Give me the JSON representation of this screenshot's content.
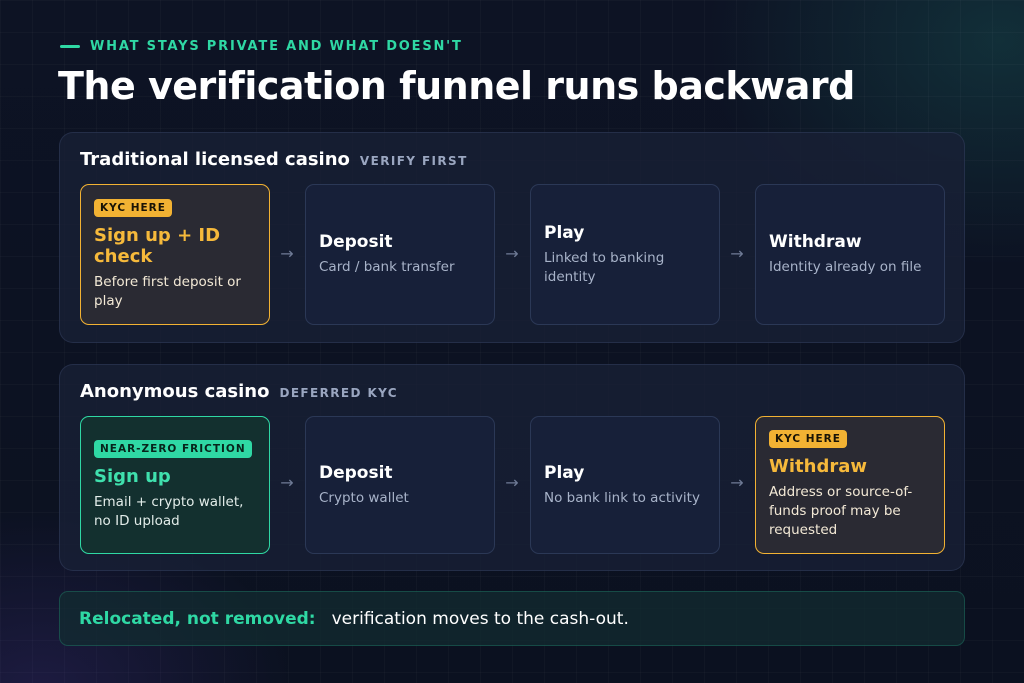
{
  "header": {
    "kicker": "WHAT STAYS PRIVATE AND WHAT DOESN'T",
    "title": "The verification funnel runs backward"
  },
  "traditional": {
    "name": "Traditional licensed casino",
    "tag": "VERIFY FIRST",
    "steps": [
      {
        "badge": "KYC HERE",
        "title": "Sign up + ID check",
        "desc": "Before first deposit or play"
      },
      {
        "title": "Deposit",
        "desc": "Card / bank transfer"
      },
      {
        "title": "Play",
        "desc": "Linked to banking identity"
      },
      {
        "title": "Withdraw",
        "desc": "Identity already on file"
      }
    ]
  },
  "anonymous": {
    "name": "Anonymous casino",
    "tag": "DEFERRED KYC",
    "steps": [
      {
        "badge": "NEAR-ZERO FRICTION",
        "title": "Sign up",
        "desc": "Email + crypto wallet, no ID upload"
      },
      {
        "title": "Deposit",
        "desc": "Crypto wallet"
      },
      {
        "title": "Play",
        "desc": "No bank link to activity"
      },
      {
        "badge": "KYC HERE",
        "title": "Withdraw",
        "desc": "Address or source-of-funds proof may be requested"
      }
    ]
  },
  "arrow_glyph": "→",
  "footer": {
    "lead": "Relocated, not removed:",
    "text": "verification moves to the cash-out."
  },
  "colors": {
    "accent_green": "#2fd8a4",
    "accent_amber": "#f2b233",
    "background": "#0d1324"
  }
}
